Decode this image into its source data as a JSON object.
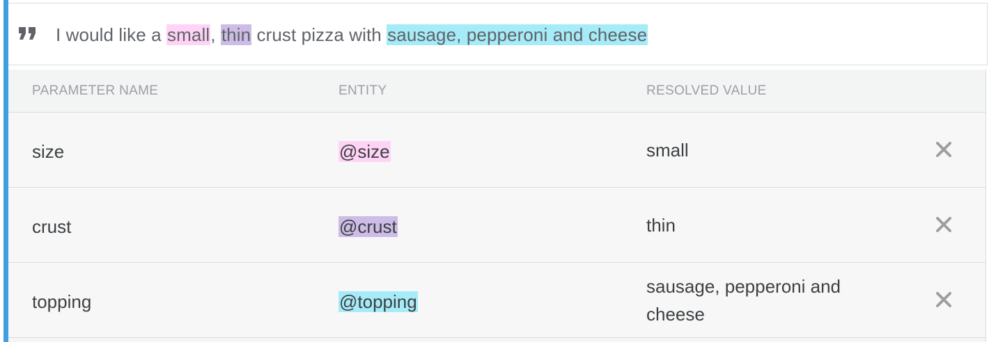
{
  "phrase": {
    "part_1": "I would like a ",
    "highlight_size": "small",
    "part_2": ", ",
    "highlight_crust": "thin",
    "part_3": " crust pizza with ",
    "highlight_topping": "sausage, pepperoni and cheese"
  },
  "table": {
    "headers": {
      "parameter_name": "PARAMETER NAME",
      "entity": "ENTITY",
      "resolved_value": "RESOLVED VALUE"
    },
    "rows": [
      {
        "parameter": "size",
        "entity": "@size",
        "value": "small",
        "entity_color": "#ffd3f5"
      },
      {
        "parameter": "crust",
        "entity": "@crust",
        "value": "thin",
        "entity_color": "#cdbde6"
      },
      {
        "parameter": "topping",
        "entity": "@topping",
        "value": "sausage, pepperoni and cheese",
        "entity_color": "#a6ecf8"
      }
    ]
  },
  "colors": {
    "accent": "#3f9fe0",
    "highlight_size": "#ffd3f5",
    "highlight_crust": "#cdbde6",
    "highlight_topping": "#a6ecf8"
  },
  "icons": {
    "quote": "quote-icon",
    "delete": "close-icon"
  }
}
